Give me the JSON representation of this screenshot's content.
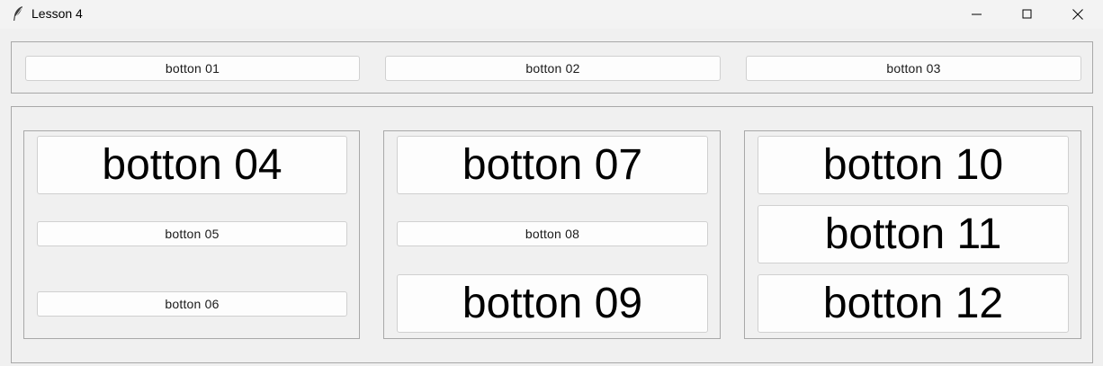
{
  "window": {
    "title": "Lesson 4",
    "app_icon": "feather-icon",
    "controls": [
      "minimize-icon",
      "maximize-icon",
      "close-icon"
    ]
  },
  "top_row": {
    "buttons": [
      "botton 01",
      "botton 02",
      "botton 03"
    ]
  },
  "lower_section": {
    "left_column": [
      "botton 04",
      "botton 05",
      "botton 06"
    ],
    "middle_column": [
      "botton 07",
      "botton 08",
      "botton 09"
    ],
    "right_column": [
      "botton 10",
      "botton 11",
      "botton 12"
    ]
  }
}
